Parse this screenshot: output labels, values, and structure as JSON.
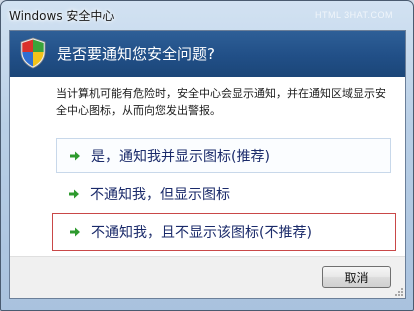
{
  "window": {
    "title": "Windows 安全中心",
    "watermark": "HTML 3HAT.COM"
  },
  "header": {
    "title": "是否要通知您安全问题?",
    "icon": "shield-icon"
  },
  "description": "当计算机可能有危险时，安全中心会显示通知，并在通知区域显示安全中心图标，从而向您发出警报。",
  "options": [
    {
      "label": "是，通知我并显示图标(推荐)",
      "icon": "green-arrow-icon"
    },
    {
      "label": "不通知我，但显示图标",
      "icon": "green-arrow-icon"
    },
    {
      "label": "不通知我，且不显示该图标(不推荐)",
      "icon": "green-arrow-icon"
    }
  ],
  "footer": {
    "cancel_label": "取消"
  },
  "colors": {
    "header_bg": "#214f87",
    "option_text": "#1a2a6a",
    "arrow": "#2e9a2e",
    "highlight_border": "#c94848"
  }
}
